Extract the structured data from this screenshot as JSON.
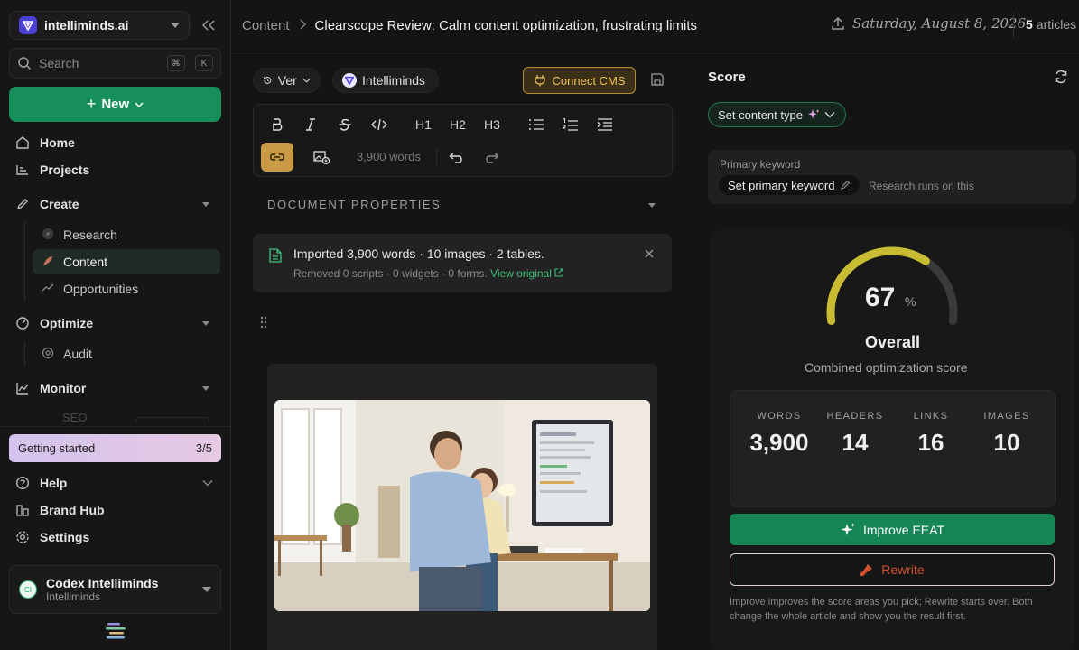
{
  "workspace": {
    "name": "intelliminds.ai"
  },
  "search": {
    "placeholder": "Search",
    "kbd1": "⌘",
    "kbd2": "K"
  },
  "new_button": {
    "label": "New"
  },
  "nav": {
    "home": "Home",
    "projects": "Projects",
    "create": "Create",
    "research": "Research",
    "content": "Content",
    "opportunities": "Opportunities",
    "optimize": "Optimize",
    "audit": "Audit",
    "monitor": "Monitor",
    "seo": "SEO",
    "help": "Help",
    "brand_hub": "Brand Hub",
    "settings": "Settings"
  },
  "getting_started": {
    "label": "Getting started",
    "progress": "3/5"
  },
  "user": {
    "initials": "CI",
    "name": "Codex Intelliminds",
    "org": "Intelliminds"
  },
  "breadcrumb": {
    "root": "Content",
    "title": "Clearscope Review: Calm content optimization, frustrating limits"
  },
  "topbar": {
    "date": "Saturday, August 8, 2026",
    "count": "5",
    "count_label": "articles"
  },
  "editor": {
    "version_label": "Ver",
    "brand_label": "Intelliminds",
    "cms_label": "Connect CMS",
    "toolbar": {
      "h1": "H1",
      "h2": "H2",
      "h3": "H3",
      "words": "3,900 words"
    },
    "doc_props": "DOCUMENT PROPERTIES",
    "import": {
      "title": "Imported 3,900 words · 10 images · 2 tables.",
      "sub": "Removed 0 scripts · 0 widgets · 0 forms.",
      "link": "View original"
    }
  },
  "score": {
    "title": "Score",
    "content_type": "Set content type",
    "keyword_label": "Primary keyword",
    "keyword_button": "Set primary keyword",
    "keyword_hint": "Research runs on this",
    "value": "67",
    "value_fraction": 0.67,
    "unit": "%",
    "overall": "Overall",
    "overall_sub": "Combined optimization score",
    "stats": [
      {
        "label": "WORDS",
        "value": "3,900"
      },
      {
        "label": "HEADERS",
        "value": "14"
      },
      {
        "label": "LINKS",
        "value": "16"
      },
      {
        "label": "IMAGES",
        "value": "10"
      }
    ],
    "improve_label": "Improve EEAT",
    "rewrite_label": "Rewrite",
    "note": "Improve improves the score areas you pick; Rewrite starts over. Both change the whole article and show you the result first."
  },
  "colors": {
    "accent_green": "#168f5b",
    "gauge_fill": "#c8bd32",
    "gauge_track": "#3a3a3a",
    "cms": "#f2c35a",
    "rewrite": "#d0532f"
  }
}
